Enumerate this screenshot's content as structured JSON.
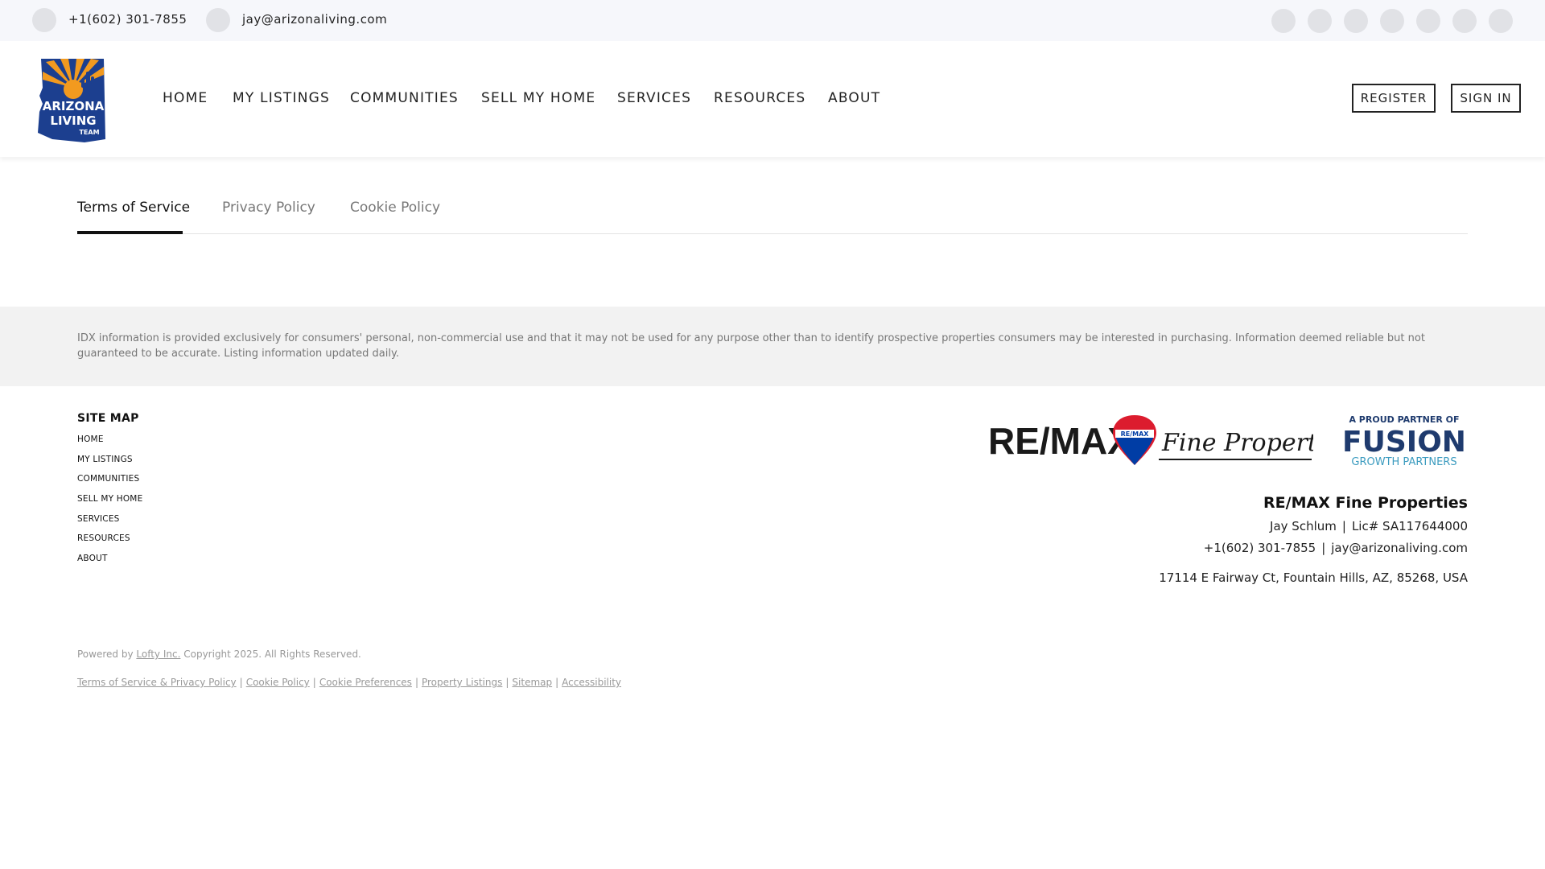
{
  "topbar": {
    "phone": "+1(602) 301-7855",
    "email": "jay@arizonaliving.com",
    "social_icons": [
      "social-icon-1",
      "social-icon-2",
      "social-icon-3",
      "social-icon-4",
      "social-icon-5",
      "social-icon-6",
      "social-icon-7"
    ]
  },
  "header": {
    "logo": {
      "line1": "ARIZONA",
      "line2": "LIVING",
      "line3": "TEAM"
    },
    "nav": [
      "HOME",
      "MY LISTINGS",
      "COMMUNITIES",
      "SELL MY HOME",
      "SERVICES",
      "RESOURCES",
      "ABOUT"
    ],
    "register_label": "REGISTER",
    "signin_label": "SIGN IN"
  },
  "tabs": {
    "items": [
      "Terms of Service",
      "Privacy Policy",
      "Cookie Policy"
    ],
    "active": "Terms of Service"
  },
  "disclaimer": "IDX information is provided exclusively for consumers' personal, non-commercial use and that it may not be used for any purpose other than to identify prospective properties consumers may be interested in purchasing. Information deemed reliable but not guaranteed to be accurate. Listing information updated daily.",
  "footer": {
    "sitemap_title": "SITE MAP",
    "sitemap": [
      "HOME",
      "MY LISTINGS",
      "COMMUNITIES",
      "SELL MY HOME",
      "SERVICES",
      "RESOURCES",
      "ABOUT"
    ],
    "remax_logo": {
      "wordmark": "RE/MAX",
      "balloon_text": "RE/MAX",
      "script": "Fine Properties"
    },
    "fusion_logo": {
      "top": "A PROUD PARTNER OF",
      "main": "FUSION",
      "bottom": "GROWTH PARTNERS"
    },
    "brokerage": "RE/MAX Fine Properties",
    "agent_name": "Jay Schlum",
    "license": "Lic# SA117644000",
    "phone": "+1(602) 301-7855",
    "email": "jay@arizonaliving.com",
    "address": "17114 E Fairway Ct, Fountain Hills, AZ, 85268, USA",
    "separator": "|",
    "powered_prefix": "Powered by",
    "powered_link": "Lofty Inc.",
    "copyright": "Copyright 2025. All Rights Reserved.",
    "legal_links": [
      "Terms of Service & Privacy Policy",
      "Cookie Policy",
      "Cookie Preferences",
      "Property Listings",
      "Sitemap",
      "Accessibility"
    ]
  },
  "colors": {
    "topbar_bg": "#f6f7fb",
    "disclaimer_bg": "#f2f2f2",
    "logo_blue": "#1c3f8f",
    "logo_orange": "#f29a1f",
    "remax_red": "#dc1c2e",
    "remax_blue": "#003da5",
    "fusion_blue": "#1f3b6e",
    "fusion_teal": "#3b9bbf"
  }
}
